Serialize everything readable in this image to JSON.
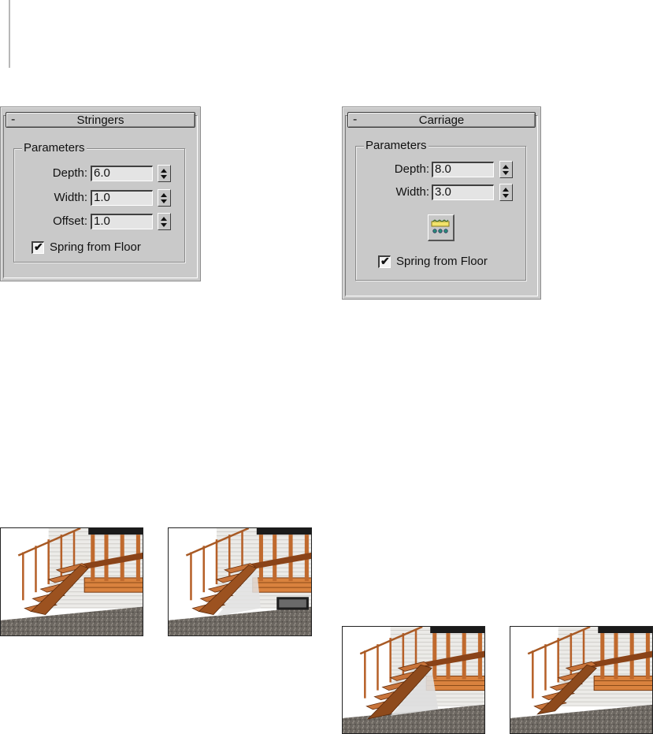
{
  "stringers": {
    "title": "Stringers",
    "collapse_symbol": "-",
    "group_label": "Parameters",
    "depth_label": "Depth:",
    "depth_value": "6.0",
    "width_label": "Width:",
    "width_value": "1.0",
    "offset_label": "Offset:",
    "offset_value": "1.0",
    "spring_label": "Spring from Floor",
    "spring_checked": true
  },
  "carriage": {
    "title": "Carriage",
    "collapse_symbol": "-",
    "group_label": "Parameters",
    "depth_label": "Depth:",
    "depth_value": "8.0",
    "width_label": "Width:",
    "width_value": "3.0",
    "carriage_button_icon": "carriage-pivot-icon",
    "spring_label": "Spring from Floor",
    "spring_checked": true
  },
  "thumbnails": {
    "stringers_renders": [
      {
        "name": "stair-render-stringers-spring-off",
        "variant": "no-spring"
      },
      {
        "name": "stair-render-stringers-spring-on",
        "variant": "spring"
      }
    ],
    "carriage_renders": [
      {
        "name": "stair-render-carriage-spring-on",
        "variant": "spring"
      },
      {
        "name": "stair-render-carriage-spring-off",
        "variant": "no-spring"
      }
    ]
  },
  "colors": {
    "panel_bg": "#c9c9c9",
    "field_bg": "#e4e4e4",
    "wood": "#c8743a",
    "wood_dark": "#7a3b12",
    "gravel": "#6f6a64",
    "siding": "#e8e6e2"
  }
}
